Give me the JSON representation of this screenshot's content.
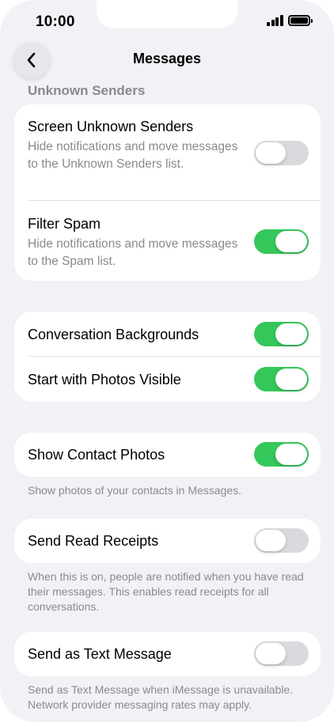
{
  "status_bar": {
    "time": "10:00"
  },
  "nav": {
    "title": "Messages"
  },
  "section_unknown": {
    "header": "Unknown Senders",
    "screen_unknown": {
      "title": "Screen Unknown Senders",
      "description": "Hide notifications and move messages to the Unknown Senders list.",
      "enabled": false
    },
    "filter_spam": {
      "title": "Filter Spam",
      "description": "Hide notifications and move messages to the Spam list.",
      "enabled": true
    }
  },
  "section_backgrounds": {
    "conversation_backgrounds": {
      "title": "Conversation Backgrounds",
      "enabled": true
    },
    "start_photos_visible": {
      "title": "Start with Photos Visible",
      "enabled": true
    }
  },
  "section_contact_photos": {
    "title": "Show Contact Photos",
    "enabled": true,
    "footnote": "Show photos of your contacts in Messages."
  },
  "section_read_receipts": {
    "title": "Send Read Receipts",
    "enabled": false,
    "footnote": "When this is on, people are notified when you have read their messages. This enables read receipts for all conversations."
  },
  "section_text_message": {
    "title": "Send as Text Message",
    "enabled": false,
    "footnote": "Send as Text Message when iMessage is unavailable. Network provider messaging rates may apply."
  },
  "colors": {
    "toggle_on": "#34c759",
    "toggle_off": "#dadade",
    "background": "#f2f1f6",
    "secondary_text": "#8a8a8e"
  },
  "icons": {
    "back": "chevron-left-icon",
    "signal": "cellular-signal-icon",
    "battery": "battery-icon"
  }
}
